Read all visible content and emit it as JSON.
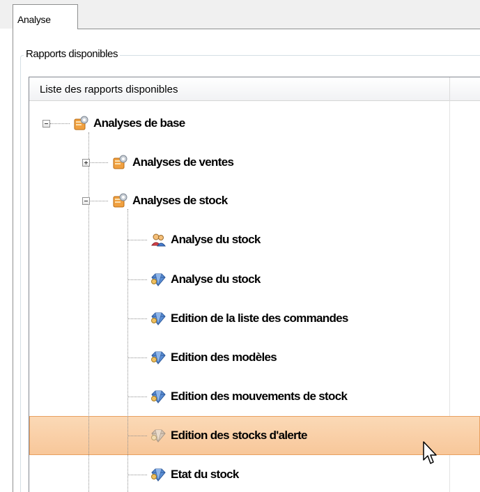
{
  "tabs": [
    {
      "label": "Analyse",
      "active": true
    }
  ],
  "group": {
    "title": "Rapports disponibles"
  },
  "tree": {
    "header": "Liste des rapports disponibles",
    "root": {
      "label": "Analyses de base",
      "expanded": true
    },
    "folders": [
      {
        "label": "Analyses de ventes",
        "expanded": false
      },
      {
        "label": "Analyses de stock",
        "expanded": true
      }
    ],
    "reports": [
      {
        "label": "Analyse du stock",
        "icon": "users-report-icon"
      },
      {
        "label": "Analyse du stock",
        "icon": "diamond-report-icon"
      },
      {
        "label": "Edition de la liste des commandes",
        "icon": "diamond-report-icon"
      },
      {
        "label": "Edition des modèles",
        "icon": "diamond-report-icon"
      },
      {
        "label": "Edition des mouvements de stock",
        "icon": "diamond-report-icon"
      },
      {
        "label": "Edition des stocks d'alerte",
        "icon": "diamond-report-icon",
        "selected": true
      },
      {
        "label": "Etat du stock",
        "icon": "diamond-report-icon"
      }
    ]
  },
  "colors": {
    "selection_fill": "#f8c79a",
    "selection_border": "#e8a060",
    "tree_line": "#8f8f8f"
  }
}
